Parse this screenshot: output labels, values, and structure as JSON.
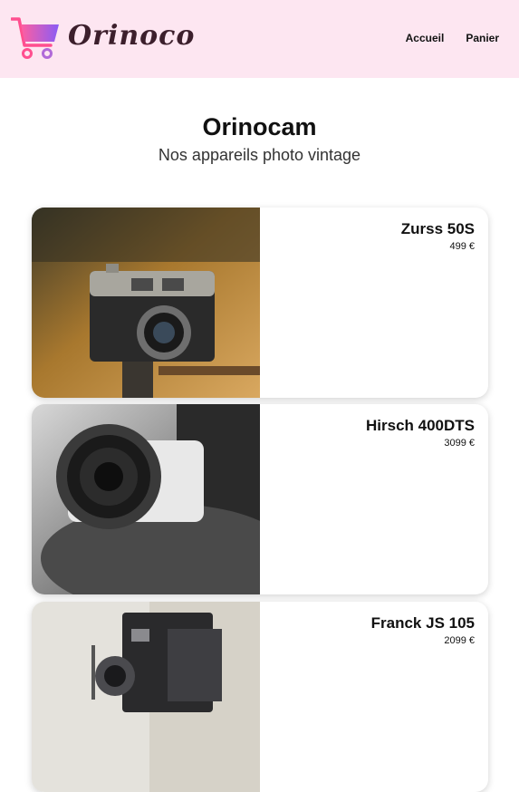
{
  "header": {
    "logo_text": "Orinoco",
    "nav": [
      {
        "label": "Accueil"
      },
      {
        "label": "Panier"
      }
    ]
  },
  "hero": {
    "title": "Orinocam",
    "subtitle": "Nos appareils photo vintage"
  },
  "products": [
    {
      "name": "Zurss 50S",
      "price": "499 €"
    },
    {
      "name": "Hirsch 400DTS",
      "price": "3099 €"
    },
    {
      "name": "Franck JS 105",
      "price": "2099 €"
    }
  ],
  "colors": {
    "header_bg": "#fde6f1",
    "logo_text": "#3c1f2c",
    "logo_gradient_start": "#ff5fa0",
    "logo_gradient_end": "#8a5cf5"
  }
}
